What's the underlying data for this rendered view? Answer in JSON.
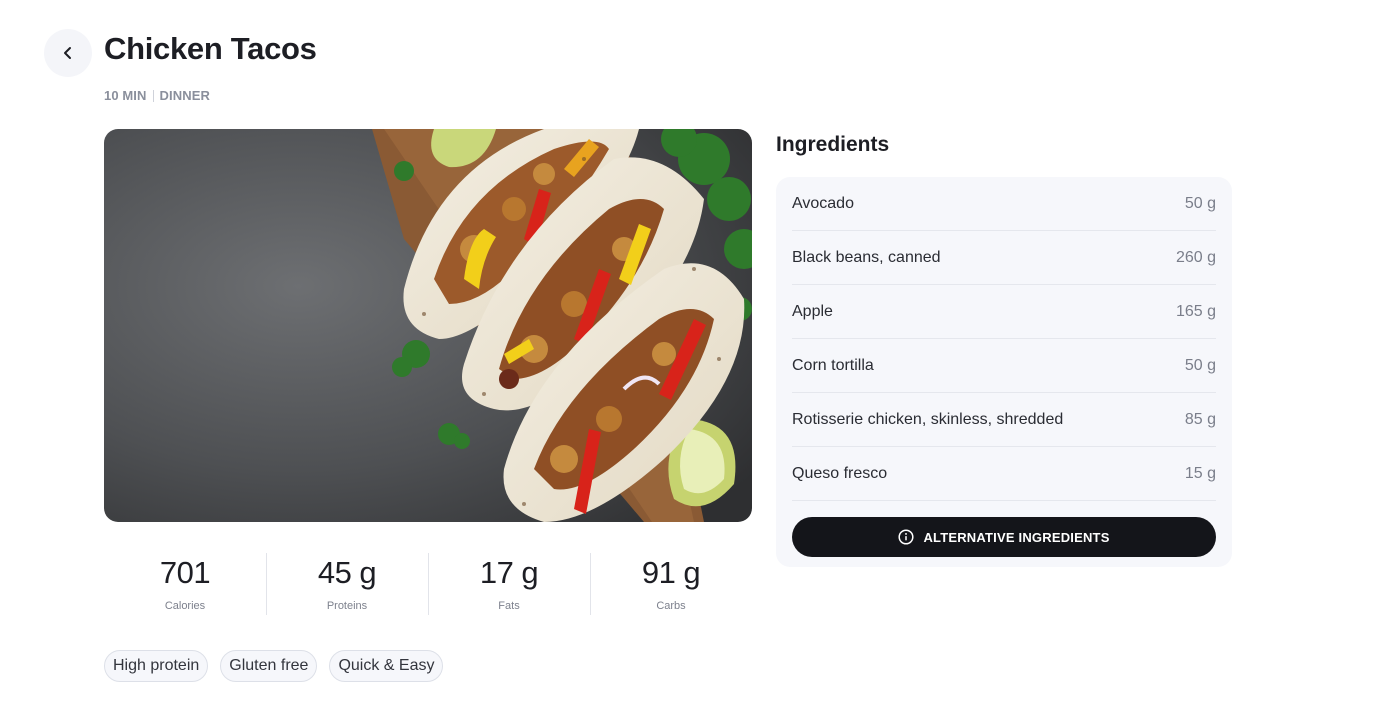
{
  "header": {
    "title": "Chicken Tacos",
    "time": "10 MIN",
    "meal_type": "DINNER"
  },
  "hero_image": {
    "description": "chicken-tacos-photo"
  },
  "nutrition": [
    {
      "value": "701",
      "label": "Calories"
    },
    {
      "value": "45 g",
      "label": "Proteins"
    },
    {
      "value": "17 g",
      "label": "Fats"
    },
    {
      "value": "91 g",
      "label": "Carbs"
    }
  ],
  "tags": [
    "High protein",
    "Gluten free",
    "Quick & Easy"
  ],
  "ingredients": {
    "title": "Ingredients",
    "items": [
      {
        "name": "Avocado",
        "qty": "50 g"
      },
      {
        "name": "Black beans, canned",
        "qty": "260 g"
      },
      {
        "name": "Apple",
        "qty": "165 g"
      },
      {
        "name": "Corn tortilla",
        "qty": "50 g"
      },
      {
        "name": "Rotisserie chicken, skinless, shredded",
        "qty": "85 g"
      },
      {
        "name": "Queso fresco",
        "qty": "15 g"
      }
    ],
    "alt_button_label": "ALTERNATIVE INGREDIENTS"
  },
  "icons": {
    "back": "chevron-left-icon",
    "info": "info-icon"
  },
  "colors": {
    "button_dark": "#14151a",
    "card_bg": "#f6f7fb",
    "muted": "#8a8f9c"
  }
}
